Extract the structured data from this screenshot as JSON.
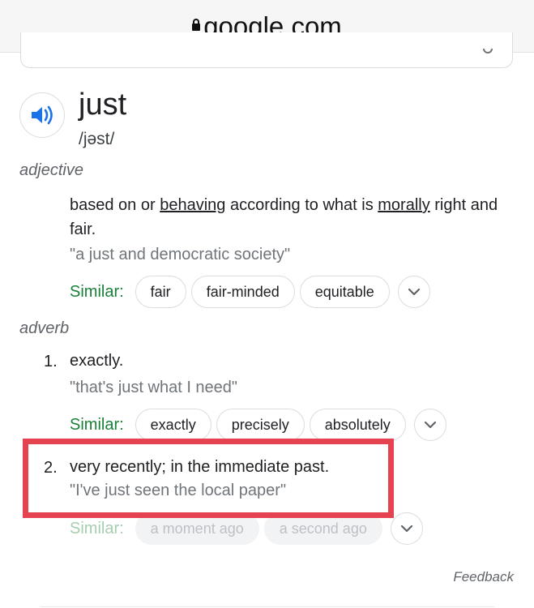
{
  "browser": {
    "domain": "google.com"
  },
  "entry": {
    "word": "just",
    "phonetic": "/jəst/",
    "adjective": {
      "pos": "adjective",
      "definition": {
        "p1": "based on or ",
        "l1": "behaving",
        "p2": " according to what is ",
        "l2": "morally",
        "p3": " right and fair."
      },
      "example": "\"a just and democratic society\"",
      "similar_label": "Similar:",
      "similar": [
        "fair",
        "fair-minded",
        "equitable"
      ]
    },
    "adverb": {
      "pos": "adverb",
      "senses": [
        {
          "number": "1.",
          "definition": "exactly.",
          "example": "\"that's just what I need\"",
          "similar_label": "Similar:",
          "similar": [
            "exactly",
            "precisely",
            "absolutely"
          ]
        },
        {
          "number": "2.",
          "definition": "very recently; in the immediate past.",
          "example": "\"I've just seen the local paper\"",
          "similar_label": "Similar:",
          "similar": [
            "a moment ago",
            "a second ago"
          ]
        }
      ]
    }
  },
  "feedback": "Feedback",
  "icons": {
    "speaker": "speaker-icon",
    "lock": "lock-icon",
    "expand": "chevron-down-icon"
  },
  "colors": {
    "similar_label": "#188038",
    "highlight_box": "#e5434f",
    "speaker": "#1a73e8"
  }
}
